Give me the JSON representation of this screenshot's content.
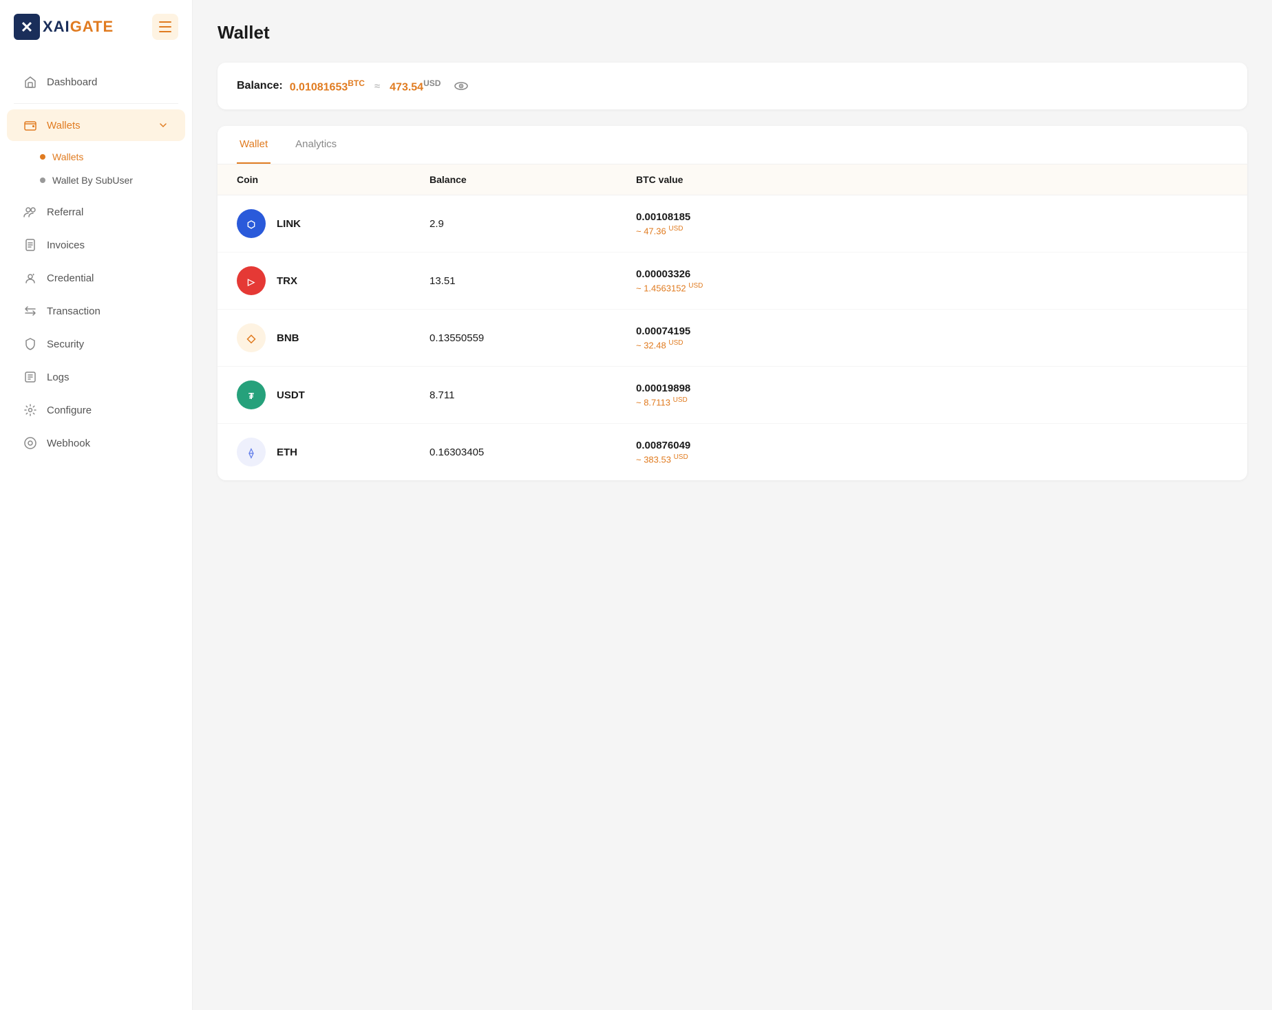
{
  "app": {
    "name_xai": "XAI",
    "name_gate": "GATE",
    "menu_toggle_label": "menu"
  },
  "sidebar": {
    "items": [
      {
        "id": "dashboard",
        "label": "Dashboard",
        "icon": "home-icon",
        "active": false,
        "has_submenu": false
      },
      {
        "id": "wallets",
        "label": "Wallets",
        "icon": "wallet-icon",
        "active": true,
        "has_submenu": true
      },
      {
        "id": "referral",
        "label": "Referral",
        "icon": "referral-icon",
        "active": false,
        "has_submenu": false
      },
      {
        "id": "invoices",
        "label": "Invoices",
        "icon": "invoice-icon",
        "active": false,
        "has_submenu": false
      },
      {
        "id": "credential",
        "label": "Credential",
        "icon": "credential-icon",
        "active": false,
        "has_submenu": false
      },
      {
        "id": "transaction",
        "label": "Transaction",
        "icon": "transaction-icon",
        "active": false,
        "has_submenu": false
      },
      {
        "id": "security",
        "label": "Security",
        "icon": "security-icon",
        "active": false,
        "has_submenu": false
      },
      {
        "id": "logs",
        "label": "Logs",
        "icon": "logs-icon",
        "active": false,
        "has_submenu": false
      },
      {
        "id": "configure",
        "label": "Configure",
        "icon": "configure-icon",
        "active": false,
        "has_submenu": false
      },
      {
        "id": "webhook",
        "label": "Webhook",
        "icon": "webhook-icon",
        "active": false,
        "has_submenu": false
      }
    ],
    "wallets_submenu": [
      {
        "id": "wallets-sub",
        "label": "Wallets",
        "active": true
      },
      {
        "id": "wallet-by-subuser",
        "label": "Wallet By SubUser",
        "active": false
      }
    ]
  },
  "page": {
    "title": "Wallet"
  },
  "balance": {
    "label": "Balance:",
    "btc_amount": "0.01081653",
    "btc_unit": "BTC",
    "approx": "≈",
    "usd_amount": "473.54",
    "usd_unit": "USD"
  },
  "tabs": [
    {
      "id": "wallet-tab",
      "label": "Wallet",
      "active": true
    },
    {
      "id": "analytics-tab",
      "label": "Analytics",
      "active": false
    }
  ],
  "table": {
    "headers": [
      "Coin",
      "Balance",
      "BTC value"
    ],
    "rows": [
      {
        "coin": "LINK",
        "coin_color": "#2a5ada",
        "coin_bg": "#e8effe",
        "balance": "2.9",
        "btc_value": "0.00108185",
        "usd_approx": "~ 47.36",
        "usd_unit": "USD"
      },
      {
        "coin": "TRX",
        "coin_color": "#e53935",
        "coin_bg": "#fce8e8",
        "balance": "13.51",
        "btc_value": "0.00003326",
        "usd_approx": "~ 1.4563152",
        "usd_unit": "USD"
      },
      {
        "coin": "BNB",
        "coin_color": "#e07b20",
        "coin_bg": "#fef3e2",
        "balance": "0.13550559",
        "btc_value": "0.00074195",
        "usd_approx": "~ 32.48",
        "usd_unit": "USD"
      },
      {
        "coin": "USDT",
        "coin_color": "#26a17b",
        "coin_bg": "#e0f4ed",
        "balance": "8.711",
        "btc_value": "0.00019898",
        "usd_approx": "~ 8.7113",
        "usd_unit": "USD"
      },
      {
        "coin": "ETH",
        "coin_color": "#627eea",
        "coin_bg": "#eef0fc",
        "balance": "0.16303405",
        "btc_value": "0.00876049",
        "usd_approx": "~ 383.53",
        "usd_unit": "USD"
      }
    ]
  }
}
